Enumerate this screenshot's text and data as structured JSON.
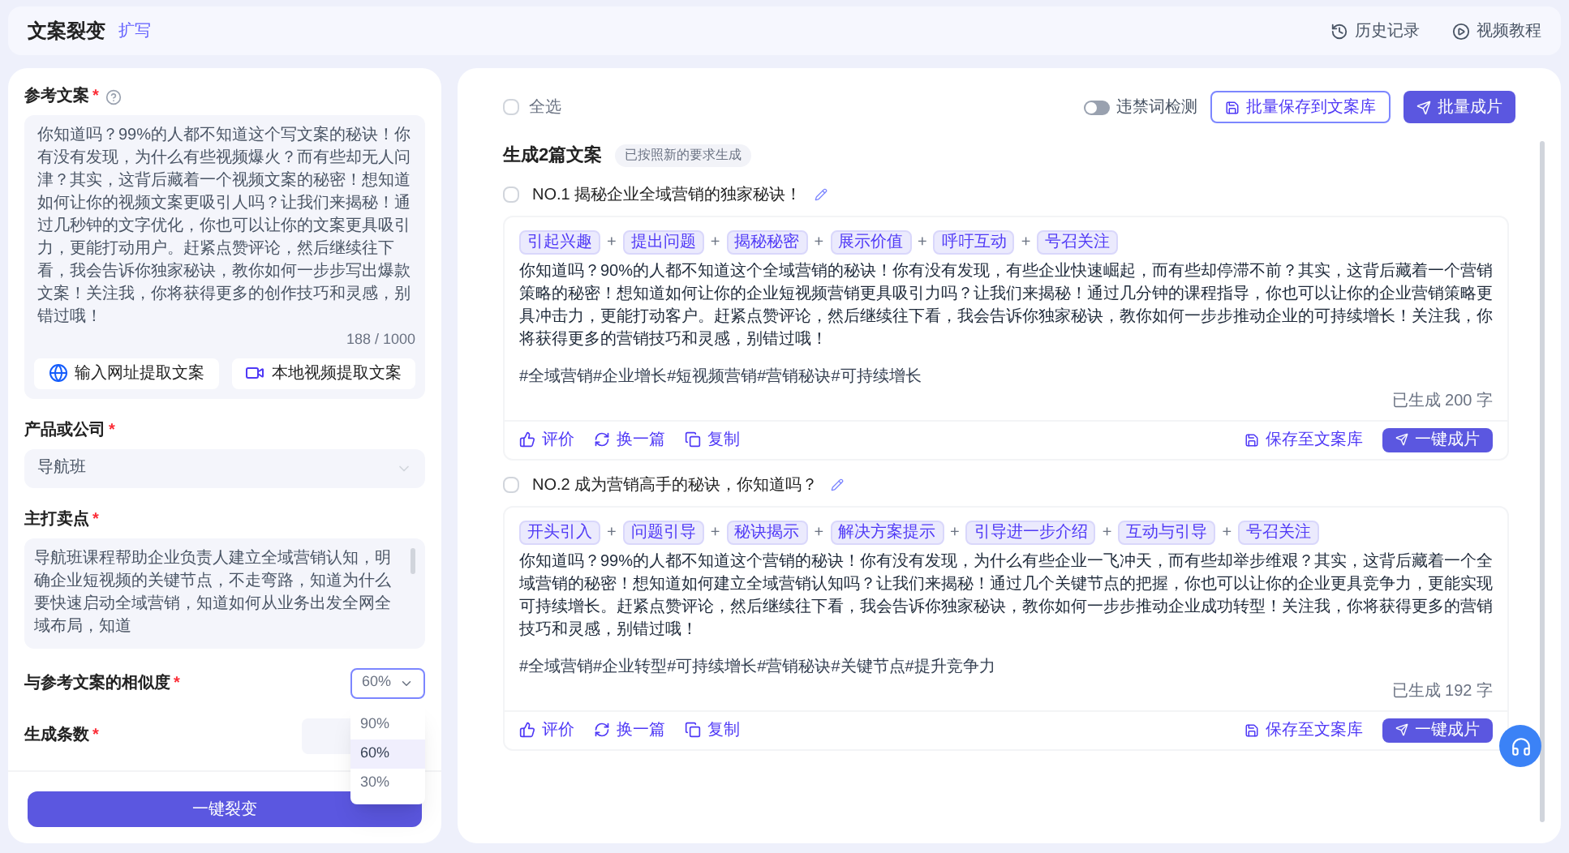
{
  "header": {
    "title": "文案裂变",
    "badge": "扩写",
    "links": [
      {
        "kind": "history",
        "label": "历史记录"
      },
      {
        "kind": "video",
        "label": "视频教程"
      }
    ]
  },
  "left": {
    "reference": {
      "label": "参考文案",
      "required_mark": "*",
      "text": "你知道吗？99%的人都不知道这个写文案的秘诀！你有没有发现，为什么有些视频爆火？而有些却无人问津？其实，这背后藏着一个视频文案的秘密！想知道如何让你的视频文案更吸引人吗？让我们来揭秘！通过几秒钟的文字优化，你也可以让你的文案更具吸引力，更能打动用户。赶紧点赞评论，然后继续往下看，我会告诉你独家秘诀，教你如何一步步写出爆款文案！关注我，你将获得更多的创作技巧和灵感，别错过哦！",
      "counter": "188 / 1000",
      "buttons": [
        {
          "kind": "web",
          "label": "输入网址提取文案"
        },
        {
          "kind": "video",
          "label": "本地视频提取文案"
        }
      ]
    },
    "product": {
      "label": "产品或公司",
      "required_mark": "*",
      "value": "导航班"
    },
    "selling_points": {
      "label": "主打卖点",
      "required_mark": "*",
      "text": "导航班课程帮助企业负责人建立全域营销认知，明确企业短视频的关键节点，不走弯路，知道为什么要快速启动全域营销，知道如何从业务出发全网全域布局，知道"
    },
    "similarity": {
      "label": "与参考文案的相似度",
      "required_mark": "*",
      "value": "60%",
      "expanded": true,
      "options": [
        {
          "label": "90%",
          "selected": false
        },
        {
          "label": "60%",
          "selected": true
        },
        {
          "label": "30%",
          "selected": false
        }
      ]
    },
    "count": {
      "label": "生成条数",
      "required_mark": "*"
    },
    "submit": "一键裂变"
  },
  "right": {
    "select_all": {
      "label": "全选",
      "checked": false
    },
    "toggle": {
      "label": "违禁词检测",
      "on": false
    },
    "save_all": "批量保存到文案库",
    "batch": "批量成片",
    "section_title": "生成2篇文案",
    "section_tag": "已按照新的要求生成",
    "results": [
      {
        "title": "NO.1 揭秘企业全域营销的独家秘诀！",
        "checked": false,
        "separator": "+",
        "tags": [
          "引起兴趣",
          "提出问题",
          "揭秘秘密",
          "展示价值",
          "呼吁互动",
          "号召关注"
        ],
        "body": "你知道吗？90%的人都不知道这个全域营销的秘诀！你有没有发现，有些企业快速崛起，而有些却停滞不前？其实，这背后藏着一个营销策略的秘密！想知道如何让你的企业短视频营销更具吸引力吗？让我们来揭秘！通过几分钟的课程指导，你也可以让你的企业营销策略更具冲击力，更能打动客户。赶紧点赞评论，然后继续往下看，我会告诉你独家秘诀，教你如何一步步推动企业的可持续增长！关注我，你将获得更多的营销技巧和灵感，别错过哦！",
        "hashtags": "#全域营销#企业增长#短视频营销#营销秘诀#可持续增长",
        "count": "已生成 200 字",
        "actions": [
          {
            "kind": "like",
            "label": "评价"
          },
          {
            "kind": "refresh",
            "label": "换一篇"
          },
          {
            "kind": "copy",
            "label": "复制"
          }
        ],
        "save": "保存至文案库",
        "make": "一键成片"
      },
      {
        "title": "NO.2 成为营销高手的秘诀，你知道吗？",
        "checked": false,
        "separator": "+",
        "tags": [
          "开头引入",
          "问题引导",
          "秘诀揭示",
          "解决方案提示",
          "引导进一步介绍",
          "互动与引导",
          "号召关注"
        ],
        "body": "你知道吗？99%的人都不知道这个营销的秘诀！你有没有发现，为什么有些企业一飞冲天，而有些却举步维艰？其实，这背后藏着一个全域营销的秘密！想知道如何建立全域营销认知吗？让我们来揭秘！通过几个关键节点的把握，你也可以让你的企业更具竞争力，更能实现可持续增长。赶紧点赞评论，然后继续往下看，我会告诉你独家秘诀，教你如何一步步推动企业成功转型！关注我，你将获得更多的营销技巧和灵感，别错过哦！",
        "hashtags": "#全域营销#企业转型#可持续增长#营销秘诀#关键节点#提升竞争力",
        "count": "已生成 192 字",
        "actions": [
          {
            "kind": "like",
            "label": "评价"
          },
          {
            "kind": "refresh",
            "label": "换一篇"
          },
          {
            "kind": "copy",
            "label": "复制"
          }
        ],
        "save": "保存至文案库",
        "make": "一键成片"
      }
    ]
  }
}
